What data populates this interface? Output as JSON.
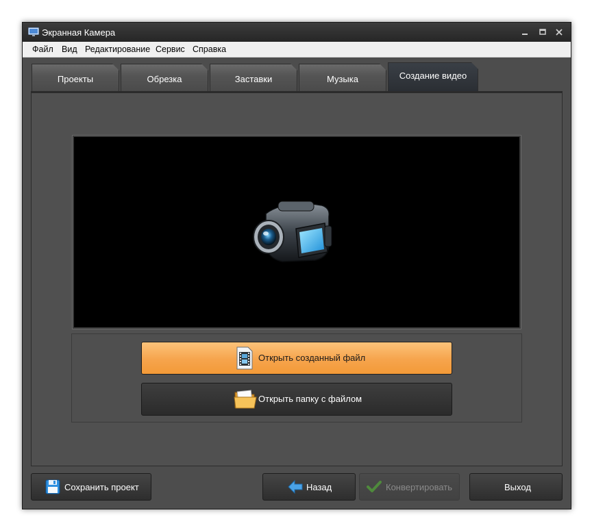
{
  "window": {
    "title": "Экранная Камера"
  },
  "menu": [
    "Файл",
    "Вид",
    "Редактирование",
    "Сервис",
    "Справка"
  ],
  "tabs": [
    {
      "label": "Проекты",
      "active": false
    },
    {
      "label": "Обрезка",
      "active": false
    },
    {
      "label": "Заставки",
      "active": false
    },
    {
      "label": "Музыка",
      "active": false
    },
    {
      "label": "Создание видео",
      "active": true
    }
  ],
  "actions": {
    "open_file": "Открыть созданный файл",
    "open_folder": "Открыть папку с файлом"
  },
  "footer": {
    "save_project": "Сохранить проект",
    "back": "Назад",
    "convert": "Конвертировать",
    "exit": "Выход"
  },
  "icons": {
    "app": "monitor-icon",
    "preview": "video-camera-icon",
    "open_file": "film-file-icon",
    "open_folder": "folder-icon",
    "save": "floppy-disk-icon",
    "back": "arrow-left-icon",
    "convert": "checkmark-icon"
  },
  "colors": {
    "accent_button": "#f6a44c",
    "window_bg": "#4d4d4d",
    "preview_bg": "#000000",
    "back_arrow": "#4aa3e8",
    "convert_check": "#4f8a3c"
  }
}
